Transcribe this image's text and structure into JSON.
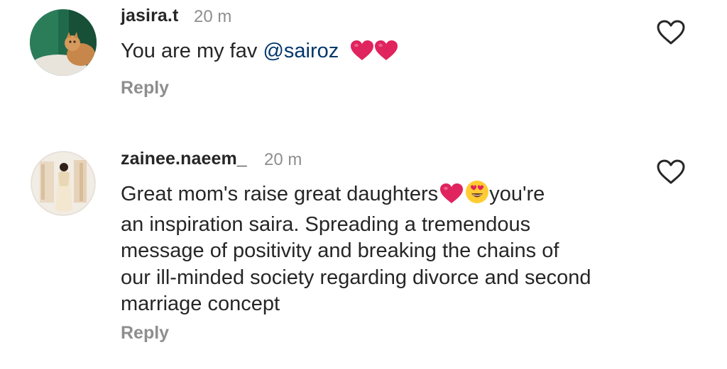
{
  "comments": [
    {
      "username": "jasira.t",
      "time": "20 m",
      "text_before": "You are my fav ",
      "mention": "@sairoz",
      "text_after": "",
      "emojis": [
        "red-heart",
        "red-heart"
      ],
      "reply_label": "Reply",
      "avatar_icon": "avatar-cat-photo"
    },
    {
      "username": "zainee.naeem_",
      "time": "20 m",
      "lines": [
        "Great mom's raise great daughters",
        "an inspiration saira. Spreading a tremendous",
        "message of positivity and breaking the chains of",
        "our ill-minded society regarding divorce and second",
        "marriage concept"
      ],
      "line1_suffix": "you're",
      "emojis": [
        "red-heart",
        "heart-eyes-face"
      ],
      "reply_label": "Reply",
      "avatar_icon": "avatar-woman-photo"
    }
  ],
  "colors": {
    "text": "#262626",
    "secondary": "#8e8e8e",
    "mention": "#00376b",
    "heart": "#e0245e"
  },
  "icons": [
    "heart-outline-icon",
    "red-heart-emoji",
    "heart-eyes-emoji"
  ]
}
